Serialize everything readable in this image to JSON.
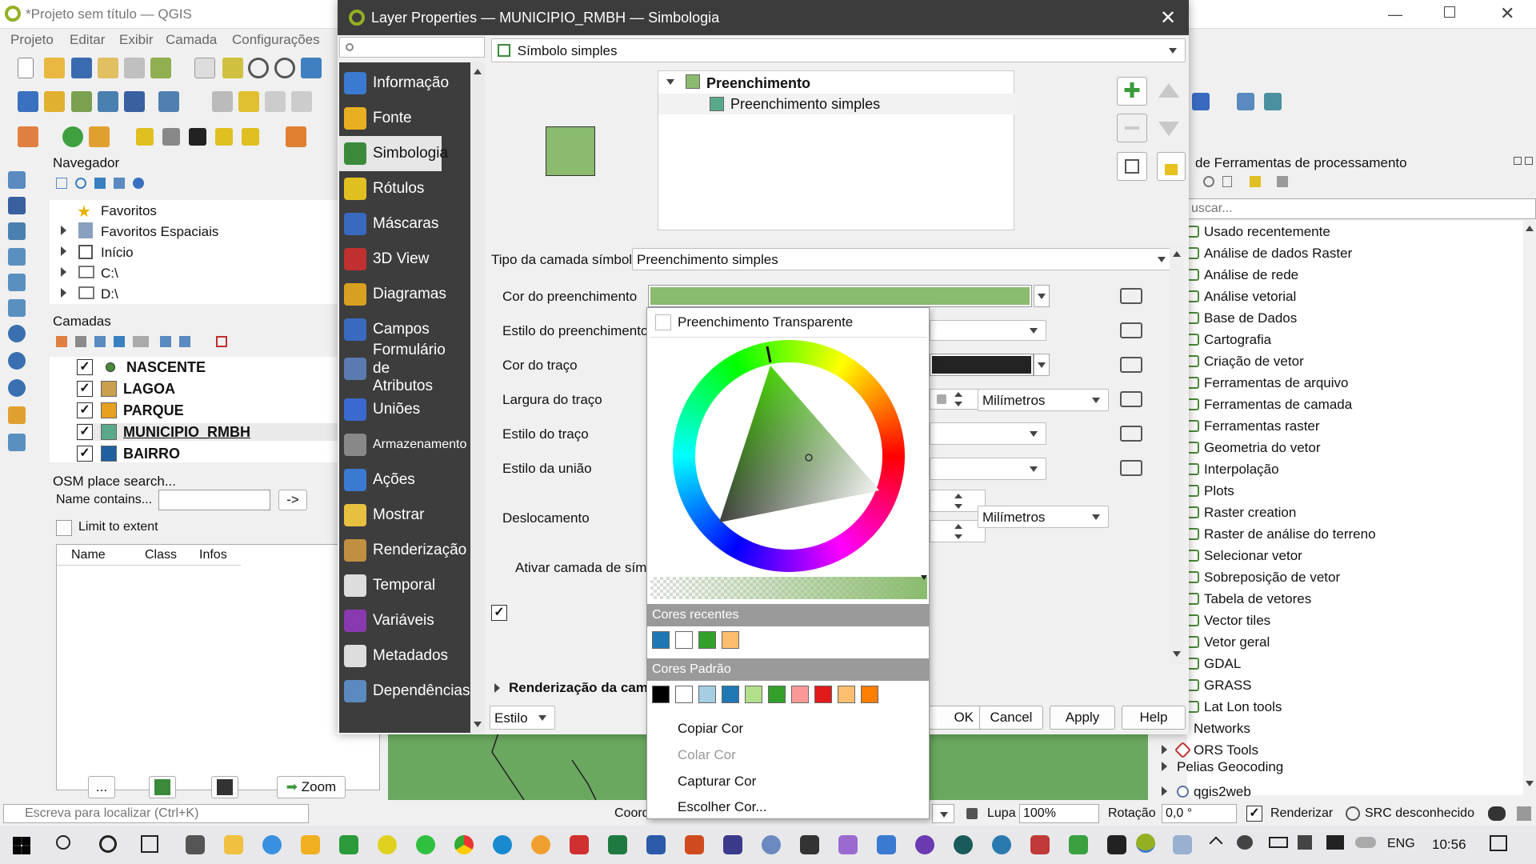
{
  "main_window": {
    "title": "*Projeto sem título — QGIS",
    "menu": [
      "Projeto",
      "Editar",
      "Exibir",
      "Camada",
      "Configurações"
    ]
  },
  "browser_panel": {
    "title": "Navegador",
    "items": [
      "Favoritos",
      "Favoritos Espaciais",
      "Início",
      "C:\\",
      "D:\\"
    ]
  },
  "layers_panel": {
    "title": "Camadas",
    "layers": [
      {
        "name": "NASCENTE",
        "color": "#4a8a3a",
        "checked": true
      },
      {
        "name": "LAGOA",
        "color": "#c8a050",
        "checked": true
      },
      {
        "name": "PARQUE",
        "color": "#e8a020",
        "checked": true
      },
      {
        "name": "MUNICIPIO_RMBH",
        "color": "#5aa88a",
        "checked": true
      },
      {
        "name": "BAIRRO",
        "color": "#2060a0",
        "checked": true
      }
    ]
  },
  "osm_panel": {
    "title": "OSM place search...",
    "name_label": "Name contains...",
    "go_label": "->",
    "limit_label": "Limit to extent",
    "columns": [
      "Name",
      "Class",
      "Infos"
    ],
    "more_label": "...",
    "zoom_label": "Zoom"
  },
  "processing_panel": {
    "title": "de Ferramentas de processamento",
    "search_placeholder": "uscar...",
    "items": [
      "Usado recentemente",
      "Análise de dados Raster",
      "Análise de rede",
      "Análise vetorial",
      "Base de Dados",
      "Cartografia",
      "Criação de vetor",
      "Ferramentas de arquivo",
      "Ferramentas de camada",
      "Ferramentas raster",
      "Geometria do vetor",
      "Interpolação",
      "Plots",
      "Raster creation",
      "Raster de análise do terreno",
      "Selecionar vetor",
      "Sobreposição de vetor",
      "Tabela de vetores",
      "Vector tiles",
      "Vetor geral",
      "GDAL",
      "GRASS",
      "Lat Lon tools",
      "Networks",
      "ORS Tools",
      "Pelias Geocoding",
      "qgis2web"
    ]
  },
  "statusbar": {
    "locator_placeholder": "Escreva para localizar (Ctrl+K)",
    "coord_label": "Coord",
    "lupa_label": "Lupa",
    "lupa_value": "100%",
    "rotation_label": "Rotação",
    "rotation_value": "0,0 °",
    "render_label": "Renderizar",
    "crs_label": "SRC desconhecido"
  },
  "dialog": {
    "title": "Layer Properties — MUNICIPIO_RMBH — Simbologia",
    "side_items": [
      "Informação",
      "Fonte",
      "Simbologia",
      "Rótulos",
      "Máscaras",
      "3D View",
      "Diagramas",
      "Campos",
      "Formulário de Atributos",
      "Uniões",
      "Armazenamento",
      "Ações",
      "Mostrar",
      "Renderização",
      "Temporal",
      "Variáveis",
      "Metadados",
      "Dependências"
    ],
    "renderer": "Símbolo simples",
    "tree_parent": "Preenchimento",
    "tree_child": "Preenchimento simples",
    "symbol_layer_type_label": "Tipo da camada símbolo",
    "symbol_layer_type": "Preenchimento simples",
    "fill_color_label": "Cor do preenchimento",
    "fill_style_label": "Estilo do preenchimento",
    "stroke_color_label": "Cor do traço",
    "stroke_width_label": "Largura do traço",
    "stroke_unit": "Milímetros",
    "stroke_style_label": "Estilo do traço",
    "join_style_label": "Estilo da união",
    "offset_label": "Deslocamento",
    "offset_unit": "Milímetros",
    "enable_label": "Ativar camada de símbo",
    "render_section": "Renderização da cam",
    "style_button": "Estilo",
    "ok": "OK",
    "cancel": "Cancel",
    "apply": "Apply",
    "help": "Help",
    "fill_color": "#8abb6e",
    "stroke_color": "#232323"
  },
  "color_popup": {
    "transparent_label": "Preenchimento Transparente",
    "recent_label": "Cores recentes",
    "recent_colors": [
      "#1f78b4",
      "#ffffff",
      "#33a02c",
      "#fdbf6f"
    ],
    "standard_label": "Cores Padrão",
    "standard_colors": [
      "#000000",
      "#ffffff",
      "#a6cee3",
      "#1f78b4",
      "#b2df8a",
      "#33a02c",
      "#fb9a99",
      "#e31a1c",
      "#fdbf6f",
      "#ff7f00"
    ],
    "copy": "Copiar Cor",
    "paste": "Colar Cor",
    "pick": "Capturar Cor",
    "choose": "Escolher Cor..."
  },
  "taskbar": {
    "lang": "ENG",
    "time": "10:56"
  }
}
